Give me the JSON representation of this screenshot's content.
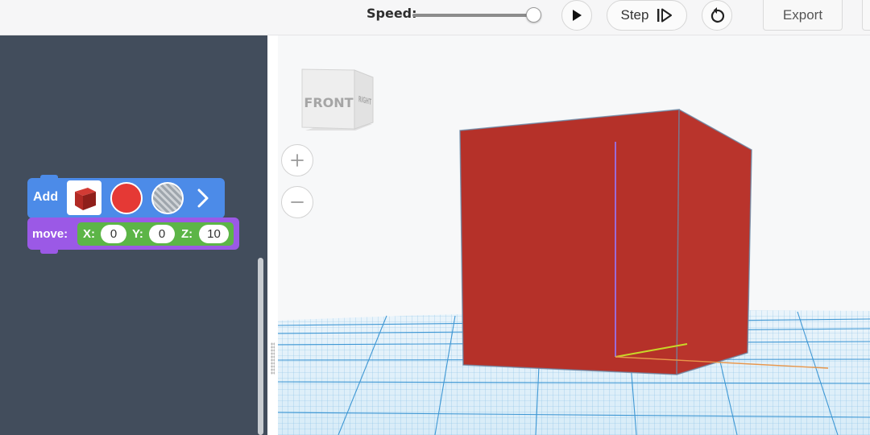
{
  "toolbar": {
    "speed_label": "Speed:",
    "speed_level": 1.0,
    "play_icon": "play-icon",
    "step_label": "Step",
    "step_icon": "step-forward-icon",
    "reset_icon": "reset-icon",
    "export_label": "Export"
  },
  "blocks": {
    "add": {
      "label": "Add",
      "shape_icon": "red-box-icon",
      "color": "#e53935",
      "hole_icon": "hole-pattern-icon",
      "expand_icon": "chevron-right-icon"
    },
    "move": {
      "label": "move:",
      "x_label": "X:",
      "x_value": "0",
      "y_label": "Y:",
      "y_value": "0",
      "z_label": "Z:",
      "z_value": "10"
    }
  },
  "viewport": {
    "view_cube_front": "FRONT",
    "view_cube_right": "RIGHT",
    "zoom_in_icon": "plus-icon",
    "zoom_out_icon": "minus-icon",
    "box_color": "#b53129",
    "grid_color": "#2f8fd0"
  }
}
